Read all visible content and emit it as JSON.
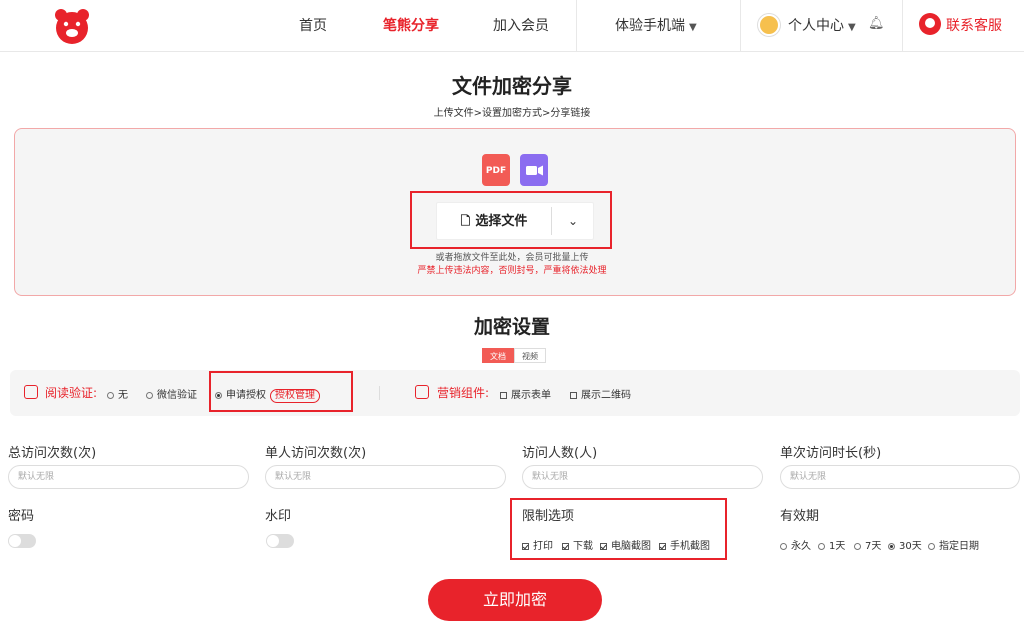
{
  "nav": {
    "items": [
      "首页",
      "笔熊分享",
      "加入会员",
      "体验手机端",
      "个人中心",
      "联系客服"
    ],
    "active_index": 1
  },
  "page": {
    "title": "文件加密分享",
    "steps": "上传文件>设置加密方式>分享链接"
  },
  "upload": {
    "pdf_label": "PDF",
    "choose_label": "选择文件",
    "hint": "或者拖放文件至此处，会员可批量上传",
    "warning": "严禁上传违法内容，否则封号，严重将依法处理"
  },
  "settings": {
    "title": "加密设置",
    "tabs": [
      "文档",
      "视频"
    ],
    "active_tab": 0,
    "read_verify": {
      "label": "阅读验证:",
      "options": [
        "无",
        "微信验证",
        "申请授权"
      ],
      "selected": 2,
      "auth_manage": "授权管理"
    },
    "marketing": {
      "label": "营销组件:",
      "options": [
        "展示表单",
        "展示二维码"
      ]
    }
  },
  "fields": {
    "total_visits": {
      "label": "总访问次数(次)",
      "placeholder": "默认无限"
    },
    "single_visits": {
      "label": "单人访问次数(次)",
      "placeholder": "默认无限"
    },
    "visitors": {
      "label": "访问人数(人)",
      "placeholder": "默认无限"
    },
    "duration": {
      "label": "单次访问时长(秒)",
      "placeholder": "默认无限"
    },
    "password": {
      "label": "密码"
    },
    "watermark": {
      "label": "水印"
    },
    "limits": {
      "label": "限制选项",
      "options": [
        "打印",
        "下载",
        "电脑截图",
        "手机截图"
      ]
    },
    "validity": {
      "label": "有效期",
      "options": [
        "永久",
        "1天",
        "7天",
        "30天",
        "指定日期"
      ],
      "selected": 3
    }
  },
  "submit_label": "立即加密",
  "colors": {
    "brand_red": "#e8232b",
    "pdf": "#f25b55",
    "video": "#8b6df0"
  }
}
